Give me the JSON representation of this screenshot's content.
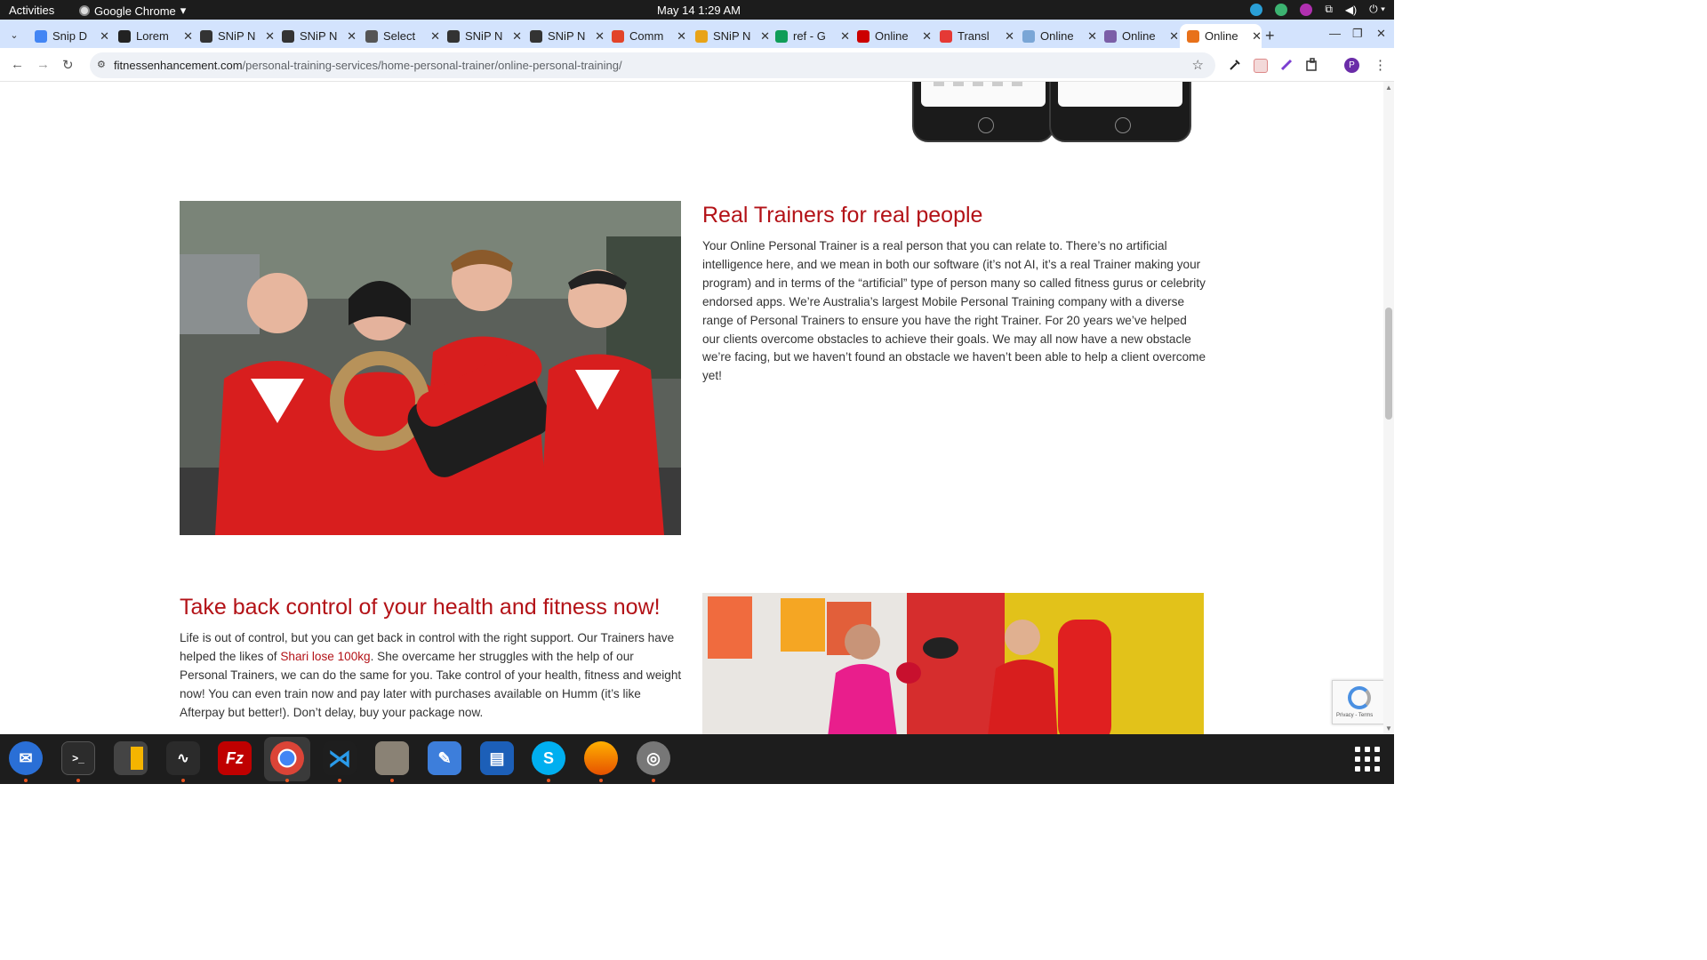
{
  "topbar": {
    "activities": "Activities",
    "app_name": "Google Chrome",
    "clock": "May 14  1:29 AM"
  },
  "tabs": [
    {
      "title": "Snip D",
      "color": "#4285f4"
    },
    {
      "title": "Lorem",
      "color": "#222222"
    },
    {
      "title": "SNiP N",
      "color": "#333333"
    },
    {
      "title": "SNiP N",
      "color": "#333333"
    },
    {
      "title": "Select",
      "color": "#555555"
    },
    {
      "title": "SNiP N",
      "color": "#333333"
    },
    {
      "title": "SNiP N",
      "color": "#333333"
    },
    {
      "title": "Comm",
      "color": "#e24329"
    },
    {
      "title": "SNiP N",
      "color": "#e8a317"
    },
    {
      "title": "ref - G",
      "color": "#0f9d58"
    },
    {
      "title": "Online",
      "color": "#cc0000"
    },
    {
      "title": "Transl",
      "color": "#e53935"
    },
    {
      "title": "Online",
      "color": "#7aa6d6"
    },
    {
      "title": "Online",
      "color": "#7b5ea7"
    },
    {
      "title": "Online",
      "color": "#e8711a",
      "active": true
    }
  ],
  "tab_new": "+",
  "address": {
    "domain": "fitnessenhancement.com",
    "path": "/personal-training-services/home-personal-trainer/online-personal-training/"
  },
  "profile_initial": "P",
  "section1": {
    "heading": "Real Trainers for real people",
    "body": "Your Online Personal Trainer is a real person that you can relate to. There’s no artificial intelligence here, and we mean in both our software (it’s not AI, it’s a real Trainer making your program) and in terms of the “artificial” type of person many so called fitness gurus or celebrity endorsed apps. We’re Australia’s largest Mobile Personal Training company with a diverse range of Personal Trainers to ensure you have the right Trainer. For 20 years we’ve helped our clients overcome obstacles to achieve their goals. We may all now have a new obstacle we’re facing, but we haven’t found an obstacle we haven’t been able to help a client overcome yet!"
  },
  "section2": {
    "heading": "Take back control of your health and fitness now!",
    "body_before": "Life is out of control, but you can get back in control with the right support. Our Trainers have helped the likes of ",
    "link": "Shari lose 100kg",
    "body_after": ". She overcame her struggles with the help of our Personal Trainers, we can do the same for you. Take control of your health, fitness and weight now! You can even train now and pay later with purchases available on Humm (it’s like Afterpay but better!). Don’t delay, buy your package now."
  },
  "recaptcha": {
    "label": "Privacy - Terms"
  },
  "colors": {
    "accent": "#b31217",
    "brand_red": "#d81e1e"
  }
}
